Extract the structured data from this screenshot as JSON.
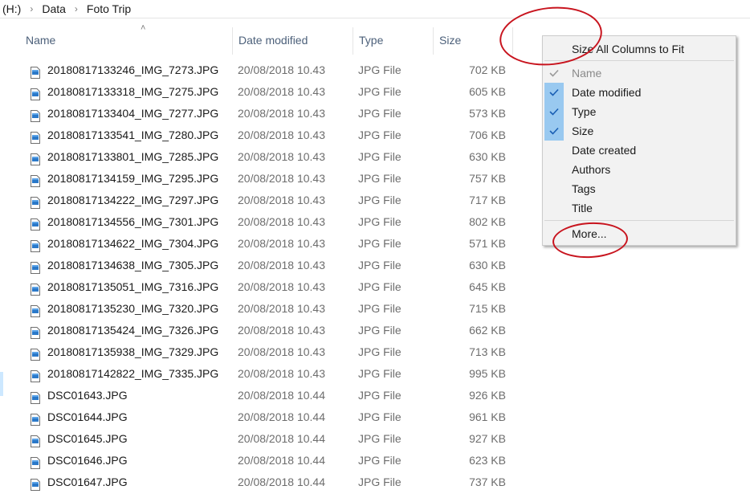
{
  "breadcrumb": [
    "(H:)",
    "Data",
    "Foto Trip"
  ],
  "columns": {
    "name": "Name",
    "date": "Date modified",
    "type": "Type",
    "size": "Size"
  },
  "files": [
    {
      "name": "20180817133246_IMG_7273.JPG",
      "date": "20/08/2018 10.43",
      "type": "JPG File",
      "size": "702 KB"
    },
    {
      "name": "20180817133318_IMG_7275.JPG",
      "date": "20/08/2018 10.43",
      "type": "JPG File",
      "size": "605 KB"
    },
    {
      "name": "20180817133404_IMG_7277.JPG",
      "date": "20/08/2018 10.43",
      "type": "JPG File",
      "size": "573 KB"
    },
    {
      "name": "20180817133541_IMG_7280.JPG",
      "date": "20/08/2018 10.43",
      "type": "JPG File",
      "size": "706 KB"
    },
    {
      "name": "20180817133801_IMG_7285.JPG",
      "date": "20/08/2018 10.43",
      "type": "JPG File",
      "size": "630 KB"
    },
    {
      "name": "20180817134159_IMG_7295.JPG",
      "date": "20/08/2018 10.43",
      "type": "JPG File",
      "size": "757 KB"
    },
    {
      "name": "20180817134222_IMG_7297.JPG",
      "date": "20/08/2018 10.43",
      "type": "JPG File",
      "size": "717 KB"
    },
    {
      "name": "20180817134556_IMG_7301.JPG",
      "date": "20/08/2018 10.43",
      "type": "JPG File",
      "size": "802 KB"
    },
    {
      "name": "20180817134622_IMG_7304.JPG",
      "date": "20/08/2018 10.43",
      "type": "JPG File",
      "size": "571 KB"
    },
    {
      "name": "20180817134638_IMG_7305.JPG",
      "date": "20/08/2018 10.43",
      "type": "JPG File",
      "size": "630 KB"
    },
    {
      "name": "20180817135051_IMG_7316.JPG",
      "date": "20/08/2018 10.43",
      "type": "JPG File",
      "size": "645 KB"
    },
    {
      "name": "20180817135230_IMG_7320.JPG",
      "date": "20/08/2018 10.43",
      "type": "JPG File",
      "size": "715 KB"
    },
    {
      "name": "20180817135424_IMG_7326.JPG",
      "date": "20/08/2018 10.43",
      "type": "JPG File",
      "size": "662 KB"
    },
    {
      "name": "20180817135938_IMG_7329.JPG",
      "date": "20/08/2018 10.43",
      "type": "JPG File",
      "size": "713 KB"
    },
    {
      "name": "20180817142822_IMG_7335.JPG",
      "date": "20/08/2018 10.43",
      "type": "JPG File",
      "size": "995 KB"
    },
    {
      "name": "DSC01643.JPG",
      "date": "20/08/2018 10.44",
      "type": "JPG File",
      "size": "926 KB"
    },
    {
      "name": "DSC01644.JPG",
      "date": "20/08/2018 10.44",
      "type": "JPG File",
      "size": "961 KB"
    },
    {
      "name": "DSC01645.JPG",
      "date": "20/08/2018 10.44",
      "type": "JPG File",
      "size": "927 KB"
    },
    {
      "name": "DSC01646.JPG",
      "date": "20/08/2018 10.44",
      "type": "JPG File",
      "size": "623 KB"
    },
    {
      "name": "DSC01647.JPG",
      "date": "20/08/2018 10.44",
      "type": "JPG File",
      "size": "737 KB"
    }
  ],
  "menu": {
    "size_all": "Size All Columns to Fit",
    "items": [
      {
        "label": "Name",
        "checked": true,
        "disabled": true
      },
      {
        "label": "Date modified",
        "checked": true,
        "disabled": false
      },
      {
        "label": "Type",
        "checked": true,
        "disabled": false
      },
      {
        "label": "Size",
        "checked": true,
        "disabled": false
      },
      {
        "label": "Date created",
        "checked": false,
        "disabled": false
      },
      {
        "label": "Authors",
        "checked": false,
        "disabled": false
      },
      {
        "label": "Tags",
        "checked": false,
        "disabled": false
      },
      {
        "label": "Title",
        "checked": false,
        "disabled": false
      }
    ],
    "more": "More..."
  },
  "colors": {
    "annotation": "#c8141e",
    "check_highlight": "#99c9f0",
    "check_mark": "#1a5fb4",
    "header_text": "#4c607a"
  },
  "icons": {
    "file": "jpg-file-icon",
    "check": "check-icon",
    "chevron": "chevron-right-icon",
    "sort": "sort-ascending-icon"
  }
}
